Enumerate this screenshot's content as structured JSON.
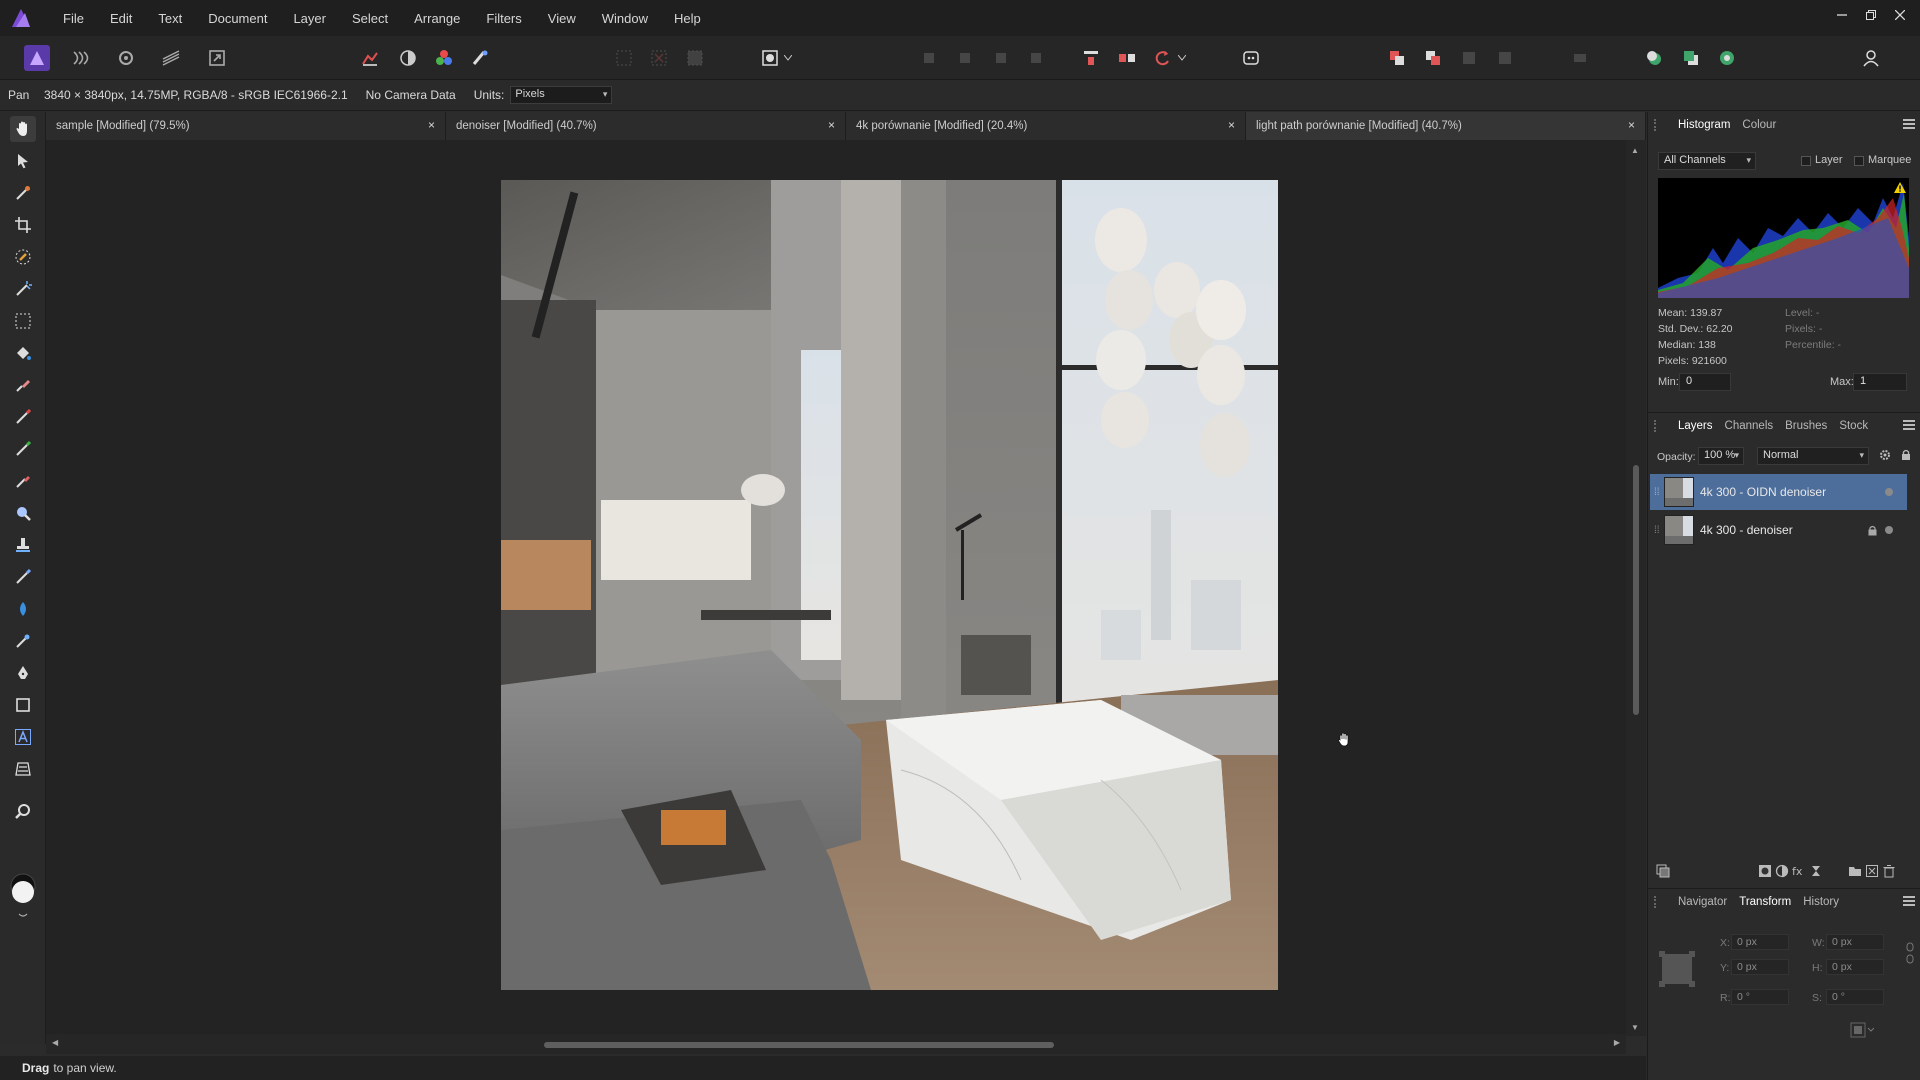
{
  "menubar": {
    "items": [
      "File",
      "Edit",
      "Text",
      "Document",
      "Layer",
      "Select",
      "Arrange",
      "Filters",
      "View",
      "Window",
      "Help"
    ],
    "controls": [
      "minimize-icon",
      "restore-icon",
      "close-icon"
    ]
  },
  "context": {
    "tool": "Pan",
    "doc_info": "3840 × 3840px, 14.75MP, RGBA/8 - sRGB IEC61966-2.1",
    "camera": "No Camera Data",
    "units_label": "Units:",
    "units_value": "Pixels"
  },
  "tabs": [
    {
      "label": "sample [Modified] (79.5%)"
    },
    {
      "label": "denoiser [Modified] (40.7%)"
    },
    {
      "label": "4k porównanie [Modified] (20.4%)"
    },
    {
      "label": "light path porównanie [Modified] (40.7%)"
    }
  ],
  "tab_close": "×",
  "histogram": {
    "tabs": [
      "Histogram",
      "Colour"
    ],
    "channel": "All Channels",
    "layer_label": "Layer",
    "marquee_label": "Marquee",
    "mean": "Mean: 139.87",
    "std": "Std. Dev.: 62.20",
    "median": "Median: 138",
    "pixels": "Pixels: 921600",
    "level": "Level: -",
    "pixels_r": "Pixels: -",
    "percentile": "Percentile: -",
    "min_label": "Min:",
    "min_value": "0",
    "max_label": "Max:",
    "max_value": "1"
  },
  "layers": {
    "tabs": [
      "Layers",
      "Channels",
      "Brushes",
      "Stock"
    ],
    "opacity_label": "Opacity:",
    "opacity_value": "100 %",
    "blend_mode": "Normal",
    "items": [
      {
        "name": "4k 300 - OIDN denoiser",
        "selected": true
      },
      {
        "name": "4k 300 - denoiser",
        "locked": true
      }
    ]
  },
  "transform": {
    "tabs": [
      "Navigator",
      "Transform",
      "History"
    ],
    "x_label": "X:",
    "x": "0 px",
    "y_label": "Y:",
    "y": "0 px",
    "w_label": "W:",
    "w": "0 px",
    "h_label": "H:",
    "h": "0 px",
    "r_label": "R:",
    "r": "0 °",
    "s_label": "S:",
    "s": "0 °"
  },
  "status": {
    "bold": "Drag",
    "text": "to pan view."
  },
  "colors": {
    "accent": "#4d6d9b",
    "brand": "#7b4bd6",
    "warning": "#f0d000"
  }
}
